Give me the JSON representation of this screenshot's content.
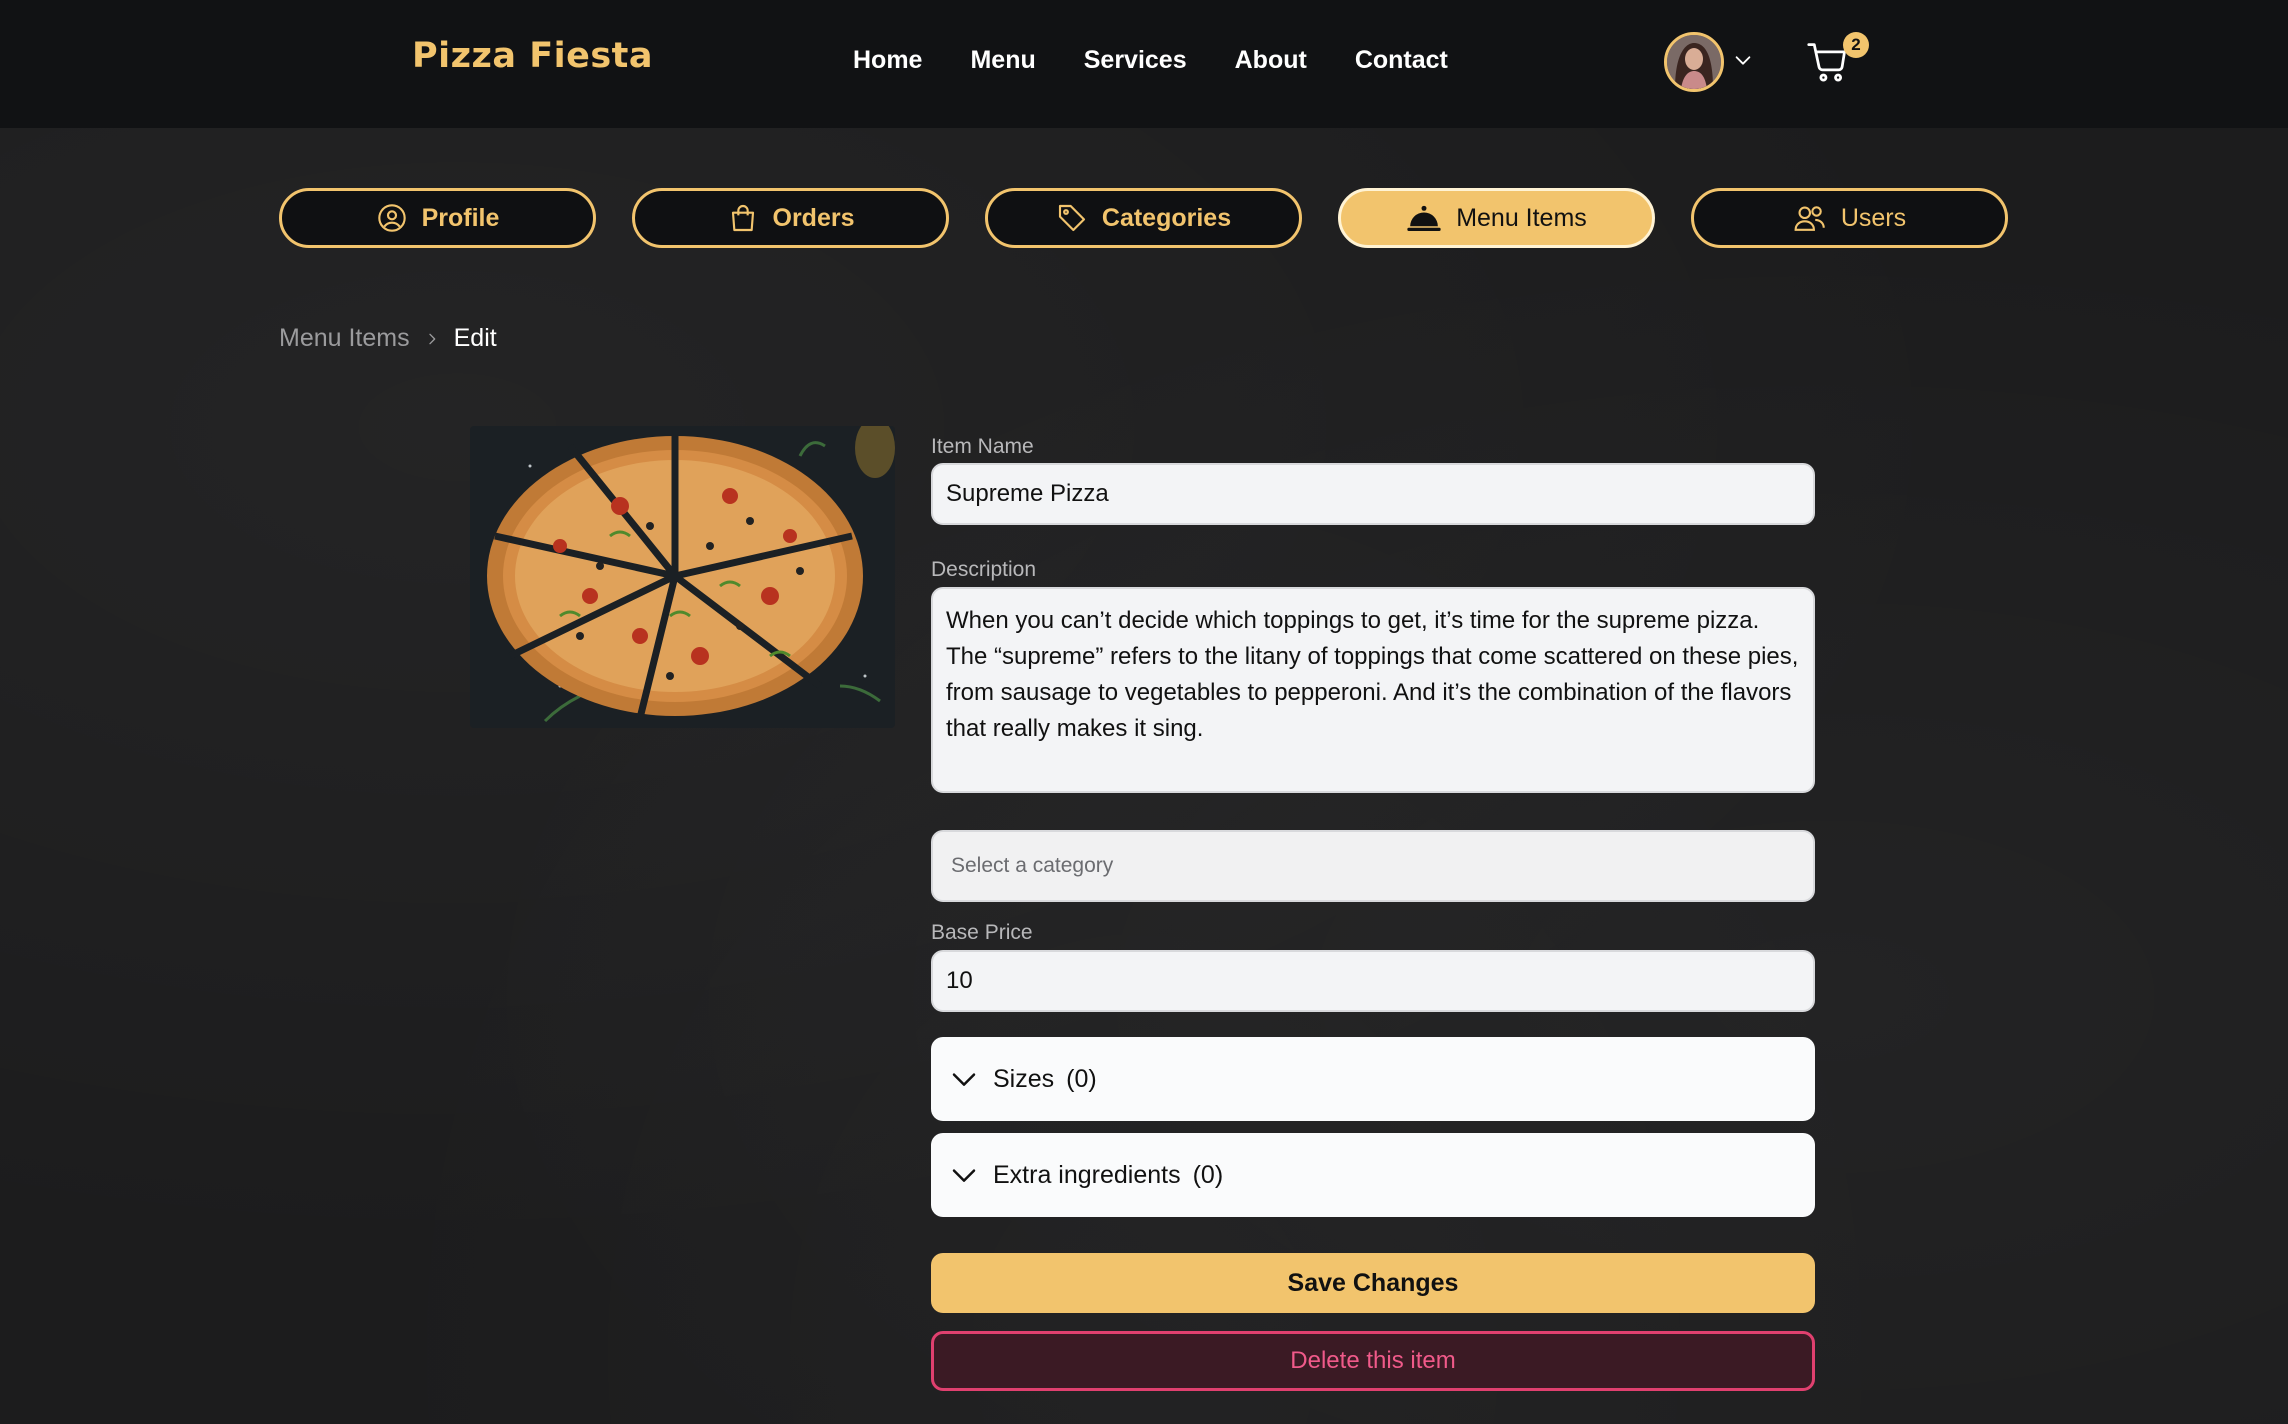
{
  "header": {
    "brand": "Pizza Fiesta",
    "nav": [
      "Home",
      "Menu",
      "Services",
      "About",
      "Contact"
    ],
    "cart_count": "2"
  },
  "tabs": [
    {
      "label": "Profile",
      "icon": "user-circle-icon",
      "active": false
    },
    {
      "label": "Orders",
      "icon": "shopping-bag-icon",
      "active": false
    },
    {
      "label": "Categories",
      "icon": "tag-icon",
      "active": false
    },
    {
      "label": "Menu Items",
      "icon": "cloche-icon",
      "active": true
    },
    {
      "label": "Users",
      "icon": "users-icon",
      "active": false
    }
  ],
  "breadcrumb": {
    "parent": "Menu Items",
    "current": "Edit"
  },
  "form": {
    "item_name_label": "Item Name",
    "item_name_value": "Supreme Pizza",
    "description_label": "Description",
    "description_value": "When you can’t decide which toppings to get, it’s time for the supreme pizza. The “supreme” refers to the litany of toppings that come scattered on these pies, from sausage to vegetables to pepperoni. And it’s the combination of the flavors that really makes it sing.",
    "category_placeholder": "Select a category",
    "base_price_label": "Base Price",
    "base_price_value": "10",
    "sizes_label": "Sizes",
    "sizes_count": "(0)",
    "extras_label": "Extra ingredients",
    "extras_count": "(0)",
    "save_label": "Save Changes",
    "delete_label": "Delete this item"
  },
  "colors": {
    "accent": "#f2c46d",
    "danger": "#e0406f",
    "header_bg": "#111214",
    "page_bg": "#1c1c1d"
  }
}
